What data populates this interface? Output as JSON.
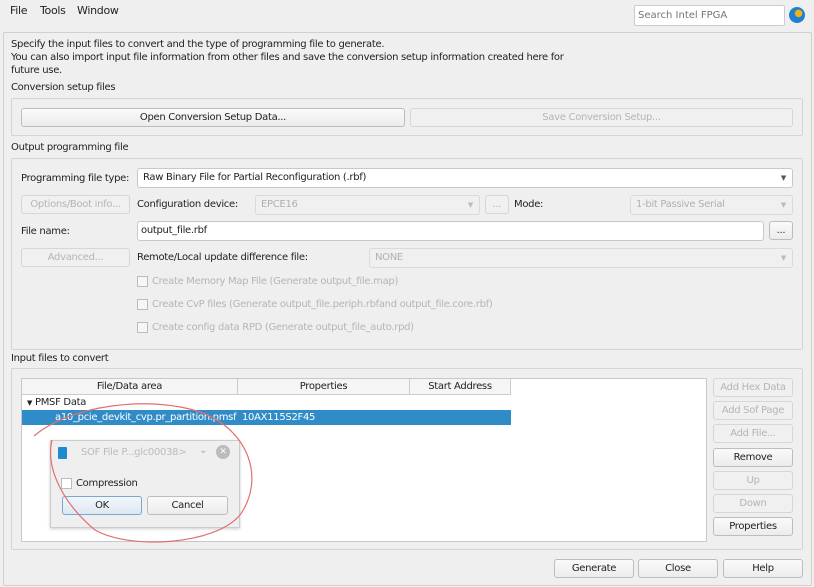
{
  "menu": [
    "File",
    "Tools",
    "Window"
  ],
  "search": {
    "placeholder": "Search Intel FPGA"
  },
  "intro": [
    "Specify the input files to convert and the type of programming file to generate.",
    "You can also import input file information from other files and save the conversion setup information created here for",
    "future use."
  ],
  "conversion": {
    "title": "Conversion setup files",
    "open": "Open Conversion Setup Data...",
    "save": "Save Conversion Setup..."
  },
  "output": {
    "title": "Output programming file",
    "type_label": "Programming file type:",
    "type_value": "Raw Binary File for Partial Reconfiguration (.rbf)",
    "options_btn": "Options/Boot info...",
    "device_label": "Configuration device:",
    "device_value": "EPCE16",
    "browse": "...",
    "mode_label": "Mode:",
    "mode_value": "1-bit Passive Serial",
    "file_label": "File name:",
    "file_value": "output_file.rbf",
    "advanced_btn": "Advanced...",
    "diff_label": "Remote/Local update difference file:",
    "diff_value": "NONE",
    "checks": [
      "Create Memory Map File (Generate output_file.map)",
      "Create CvP files (Generate output_file.periph.rbfand output_file.core.rbf)",
      "Create config data RPD (Generate output_file_auto.rpd)"
    ]
  },
  "input": {
    "title": "Input files to convert",
    "columns": [
      "File/Data area",
      "Properties",
      "Start Address"
    ],
    "group": "PMSF Data",
    "row": {
      "file": "a10_pcie_devkit_cvp.pr_partition.pmsf",
      "props": "10AX115S2F45"
    },
    "buttons": [
      "Add Hex Data",
      "Add Sof Page",
      "Add File...",
      "Remove",
      "Up",
      "Down",
      "Properties"
    ]
  },
  "popup": {
    "title": "SOF File P...glc00038>",
    "checkbox": "Compression",
    "ok": "OK",
    "cancel": "Cancel"
  },
  "footer": [
    "Generate",
    "Close",
    "Help"
  ],
  "colors": {
    "selection": "#308cc6",
    "annotation": "#e07070"
  }
}
